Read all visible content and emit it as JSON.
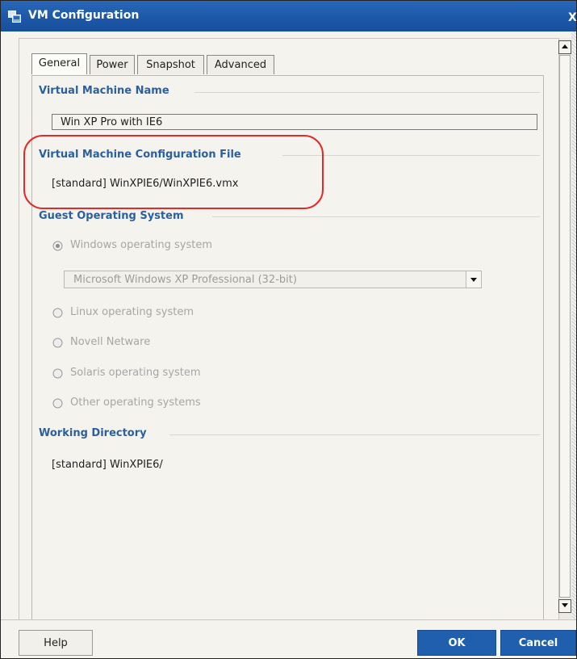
{
  "window": {
    "title": "VM Configuration",
    "close_glyph": "X",
    "app_icon": "vm-config-icon",
    "titlebar_color": "#1d58a8"
  },
  "tabs": [
    {
      "label": "General",
      "active": true
    },
    {
      "label": "Power",
      "active": false
    },
    {
      "label": "Snapshot",
      "active": false
    },
    {
      "label": "Advanced",
      "active": false
    }
  ],
  "general": {
    "vm_name": {
      "heading": "Virtual Machine Name",
      "value": "Win XP Pro with IE6"
    },
    "config_file": {
      "heading": "Virtual Machine Configuration File",
      "value": "[standard] WinXPIE6/WinXPIE6.vmx",
      "highlight_color": "#e22a2a"
    },
    "guest_os": {
      "heading": "Guest Operating System",
      "options": [
        {
          "label": "Windows operating system",
          "selected": true
        },
        {
          "label": "Linux operating system",
          "selected": false
        },
        {
          "label": "Novell Netware",
          "selected": false
        },
        {
          "label": "Solaris operating system",
          "selected": false
        },
        {
          "label": "Other operating systems",
          "selected": false
        }
      ],
      "version_select": {
        "value": "Microsoft Windows XP Professional (32-bit)",
        "disabled": true
      }
    },
    "working_directory": {
      "heading": "Working Directory",
      "value": "[standard] WinXPIE6/"
    }
  },
  "footer": {
    "help_label": "Help",
    "ok_label": "OK",
    "cancel_label": "Cancel",
    "button_color": "#1f5fae"
  },
  "colors": {
    "section_heading": "#2b5f9e",
    "disabled_text": "#a6a6a6",
    "panel_background": "#f4f3ee"
  }
}
